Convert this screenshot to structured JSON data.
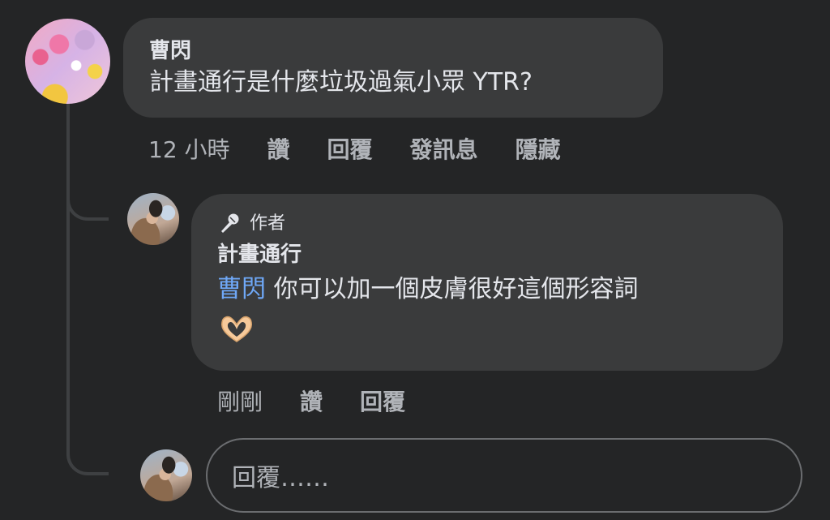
{
  "comment": {
    "author": "曹閃",
    "text": "計畫通行是什麼垃圾過氣小眾 YTR?",
    "actions": {
      "time": "12 小時",
      "like": "讚",
      "reply": "回覆",
      "message": "發訊息",
      "hide": "隱藏"
    }
  },
  "reply": {
    "badge": "作者",
    "badge_icon": "microphone-icon",
    "author": "計畫通行",
    "mention": "曹閃",
    "text": " 你可以加一個皮膚很好這個形容詞",
    "emoji": "heart-hands-emoji",
    "actions": {
      "time": "剛剛",
      "like": "讚",
      "reply": "回覆"
    }
  },
  "compose": {
    "placeholder": "回覆……"
  },
  "colors": {
    "background": "#242526",
    "bubble": "#3a3b3c",
    "text": "#e4e6eb",
    "secondary_text": "#b0b3b8",
    "mention": "#6fa8f7"
  }
}
